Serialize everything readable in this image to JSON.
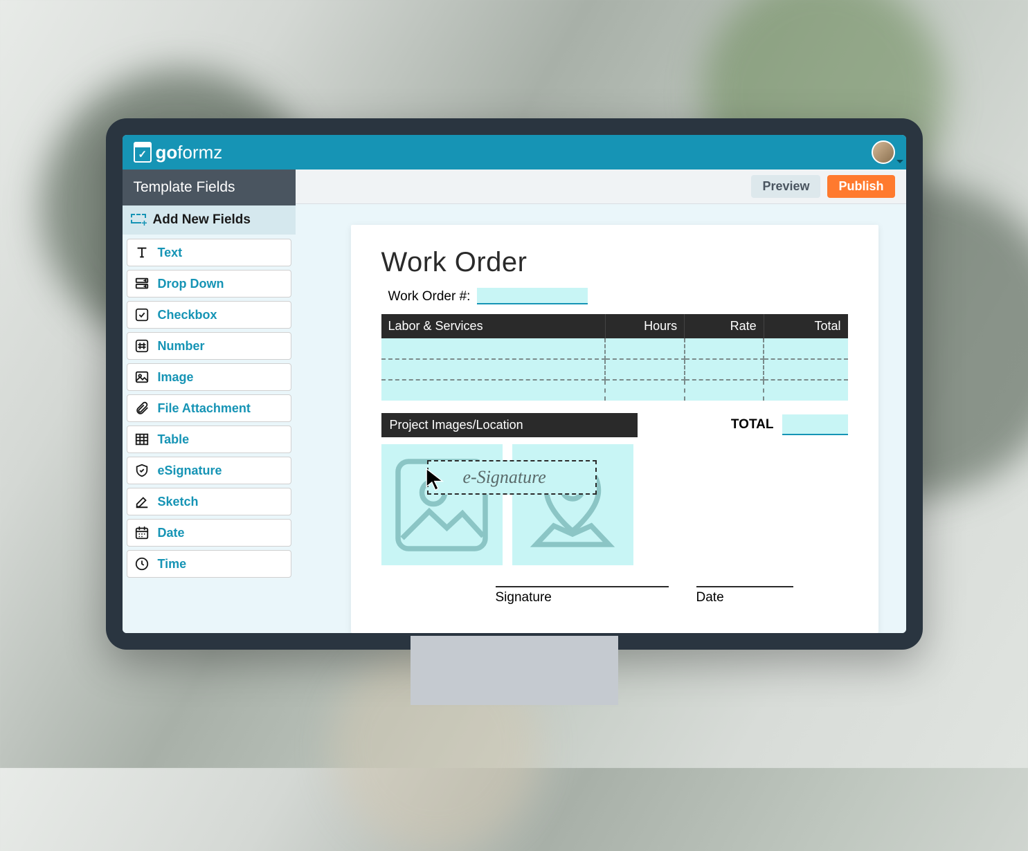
{
  "brand": {
    "part1": "go",
    "part2": "formz"
  },
  "toolbar": {
    "preview": "Preview",
    "publish": "Publish"
  },
  "sidebar": {
    "title": "Template Fields",
    "add_new": "Add New Fields",
    "fields": [
      {
        "label": "Text"
      },
      {
        "label": "Drop Down"
      },
      {
        "label": "Checkbox"
      },
      {
        "label": "Number"
      },
      {
        "label": "Image"
      },
      {
        "label": "File Attachment"
      },
      {
        "label": "Table"
      },
      {
        "label": "eSignature"
      },
      {
        "label": "Sketch"
      },
      {
        "label": "Date"
      },
      {
        "label": "Time"
      }
    ]
  },
  "form": {
    "title": "Work Order",
    "wo_label": "Work Order #:",
    "table_headers": {
      "c1": "Labor & Services",
      "c2": "Hours",
      "c3": "Rate",
      "c4": "Total"
    },
    "section2": "Project Images/Location",
    "total_label": "TOTAL",
    "signature_label": "Signature",
    "date_label": "Date"
  },
  "drag": {
    "ghost_text": "e-Signature"
  }
}
